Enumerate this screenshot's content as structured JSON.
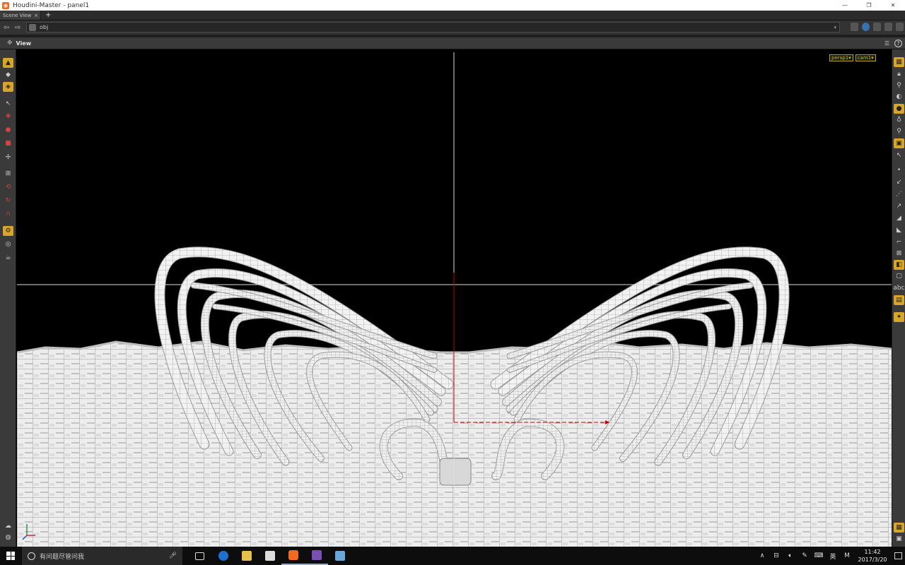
{
  "window": {
    "title": "Houdini-Master - panel1",
    "minimize": "—",
    "restore": "❐",
    "close": "✕"
  },
  "tabs": [
    {
      "label": "Scene View",
      "close": "×"
    }
  ],
  "tab_add": "+",
  "path": {
    "back": "⇦",
    "forward": "⇨",
    "value": "obj",
    "dropdown": "▾"
  },
  "view_panel": {
    "title": "View",
    "cameras": [
      "persp1▾",
      "cam1▾"
    ],
    "help": "?"
  },
  "taskbar": {
    "search_placeholder": "有问题尽管问我",
    "clock_time": "11:42",
    "clock_date": "2017/3/20",
    "ime": "英",
    "ime_mode": "M",
    "tray_caret": "∧"
  },
  "colors": {
    "accent_tool": "#d7a52a",
    "viewport_bg": "#000000",
    "mesh": "#f0f0f0",
    "axis_red": "#c00000"
  },
  "icons": {
    "left_tools": [
      "handle-tool-icon",
      "view-tool-icon",
      "pose-tool-icon",
      "select-icon",
      "translate-icon",
      "rotate-icon",
      "scale-icon",
      "transform-icon",
      "lasso-icon",
      "brush-icon",
      "paint-icon",
      "magnet-icon",
      "snap-icon",
      "camera-lock-icon",
      "render-icon"
    ],
    "right_tools": [
      "display-options-icon",
      "lock-icon",
      "link-icon",
      "ghost-icon",
      "shade-icon",
      "light-icon",
      "pin-icon",
      "camera-icon",
      "cursor-icon",
      "dot-icon",
      "line-icon",
      "point-icon",
      "normal-icon",
      "vertex-icon",
      "grid-icon",
      "box-icon",
      "text-icon",
      "label-icon",
      "image-icon",
      "bulb-icon"
    ]
  }
}
